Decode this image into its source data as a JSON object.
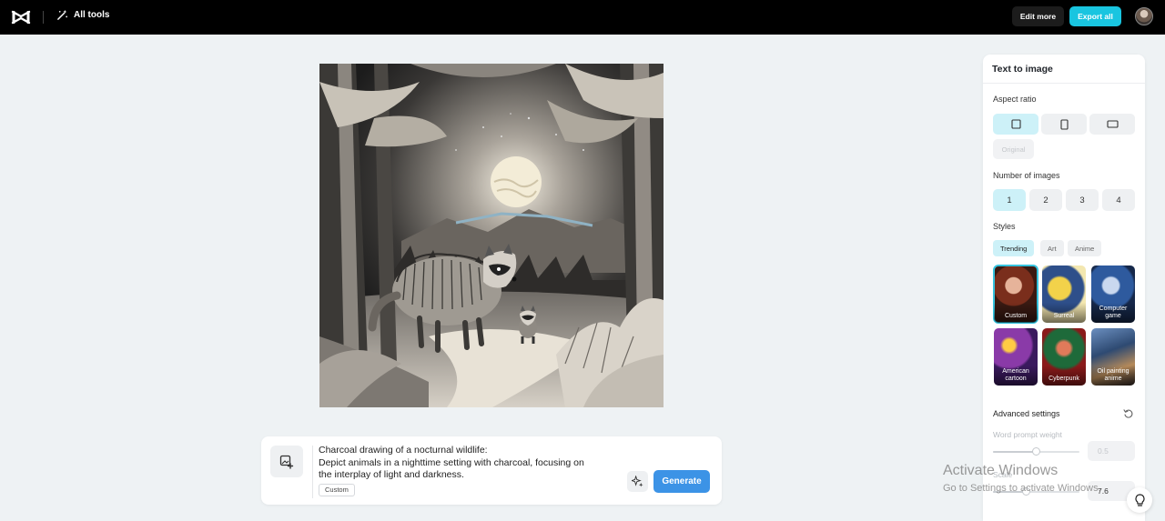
{
  "topbar": {
    "logo_icon": "capcut-logo-icon",
    "all_tools_label": "All tools",
    "edit_more_label": "Edit more",
    "export_all_label": "Export all",
    "accent_color": "#19c5e0"
  },
  "prompt": {
    "text": "Charcoal drawing of a nocturnal wildlife:\nDepict animals in a nighttime setting with charcoal, focusing on\nthe interplay of light and darkness.",
    "tag": "Custom",
    "generate_label": "Generate"
  },
  "panel": {
    "title": "Text to image",
    "aspect_ratio_label": "Aspect ratio",
    "aspect_ratios": [
      "square",
      "portrait",
      "landscape"
    ],
    "original_label": "Original",
    "number_label": "Number of images",
    "numbers": [
      "1",
      "2",
      "3",
      "4"
    ],
    "selected_number": "1",
    "styles_label": "Styles",
    "style_tabs": [
      "Trending",
      "Art",
      "Anime"
    ],
    "styles": [
      {
        "label": "Custom"
      },
      {
        "label": "Surreal"
      },
      {
        "label": "Computer game"
      },
      {
        "label": "American cartoon"
      },
      {
        "label": "Cyberpunk"
      },
      {
        "label": "Oil painting anime"
      }
    ],
    "advanced_label": "Advanced settings",
    "word_prompt_weight_label": "Word prompt weight",
    "word_prompt_weight_value": "0.5",
    "scale_label": "Scale",
    "scale_value": "7.6"
  },
  "watermark": {
    "line1": "Activate Windows",
    "line2": "Go to Settings to activate Windows."
  }
}
